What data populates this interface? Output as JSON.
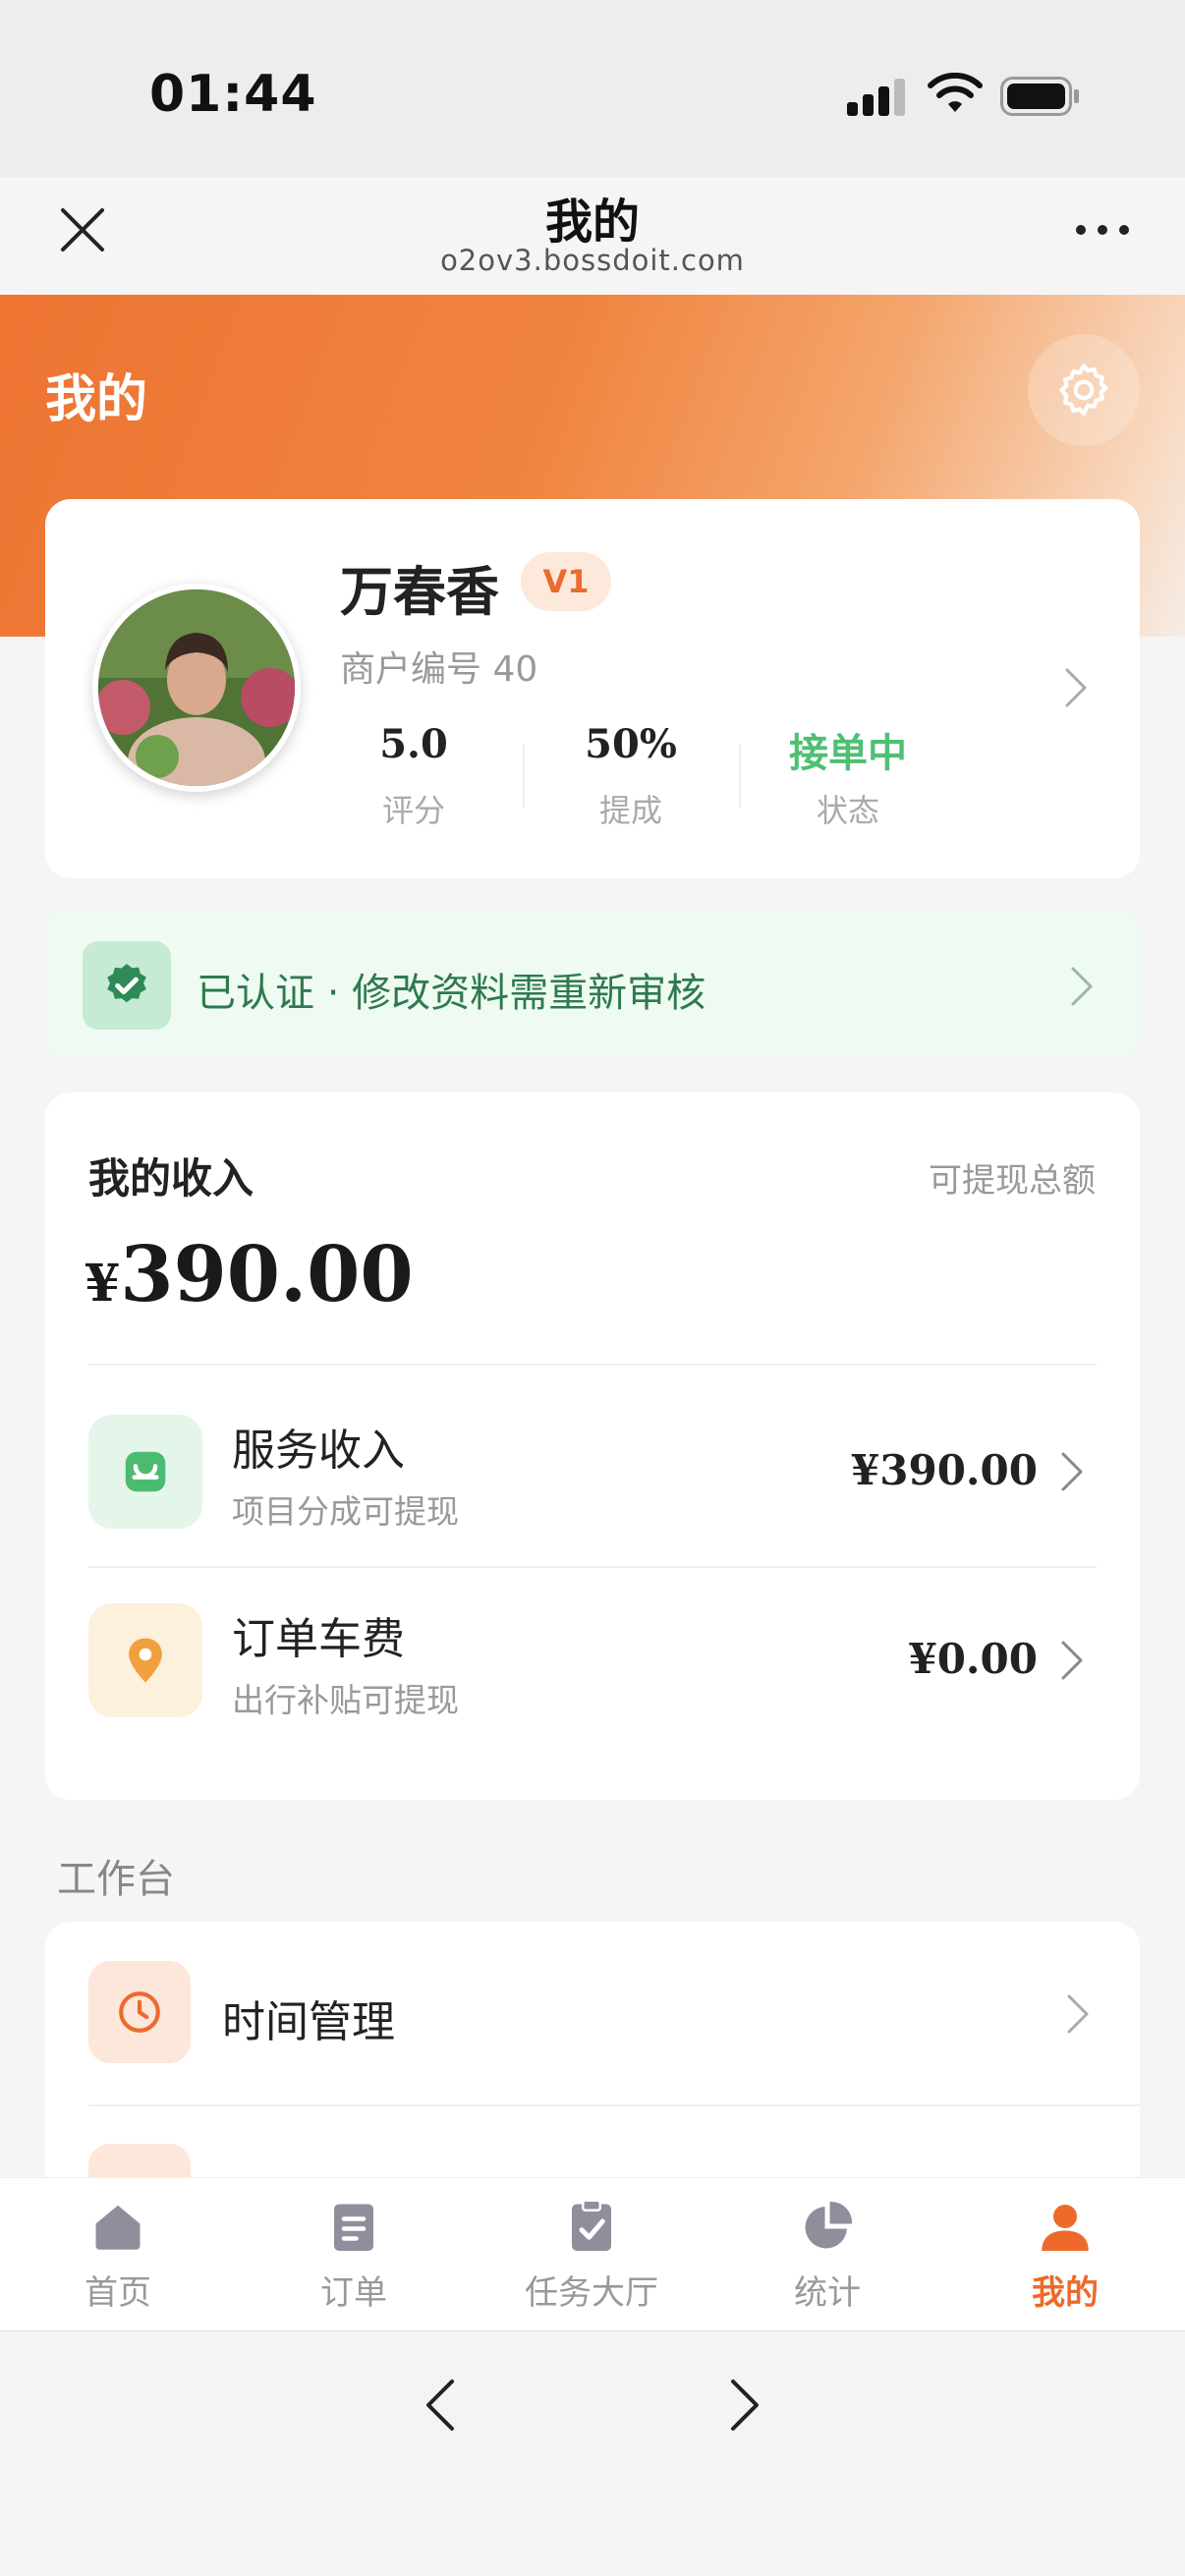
{
  "status_bar": {
    "time": "01:44"
  },
  "browser": {
    "title": "我的",
    "url": "o2ov3.bossdoit.com"
  },
  "header": {
    "title": "我的"
  },
  "profile": {
    "name": "万春香",
    "level": "V1",
    "merchant_no": "商户编号 40",
    "stats": [
      {
        "value": "5.0",
        "label": "评分"
      },
      {
        "value": "50%",
        "label": "提成"
      },
      {
        "value": "接单中",
        "label": "状态"
      }
    ]
  },
  "verification": {
    "text": "已认证 · 修改资料需重新审核"
  },
  "income": {
    "title": "我的收入",
    "withdraw_label": "可提现总额",
    "currency": "¥",
    "total": "390.00",
    "rows": [
      {
        "title": "服务收入",
        "subtitle": "项目分成可提现",
        "amount": "¥390.00",
        "icon": "smile-bag-icon",
        "color": "#4cbb72"
      },
      {
        "title": "订单车费",
        "subtitle": "出行补贴可提现",
        "amount": "¥0.00",
        "icon": "location-pin-icon",
        "color": "#f0a03c"
      }
    ]
  },
  "workbench": {
    "label": "工作台",
    "items": [
      {
        "title": "时间管理",
        "icon": "clock-icon"
      }
    ]
  },
  "tabs": [
    {
      "label": "首页",
      "icon": "home-icon",
      "active": false
    },
    {
      "label": "订单",
      "icon": "clipboard-list-icon",
      "active": false
    },
    {
      "label": "任务大厅",
      "icon": "clipboard-check-icon",
      "active": false
    },
    {
      "label": "统计",
      "icon": "pie-chart-icon",
      "active": false
    },
    {
      "label": "我的",
      "icon": "user-icon",
      "active": true
    }
  ],
  "colors": {
    "accent": "#ee6a2a",
    "green": "#4fbf73"
  }
}
